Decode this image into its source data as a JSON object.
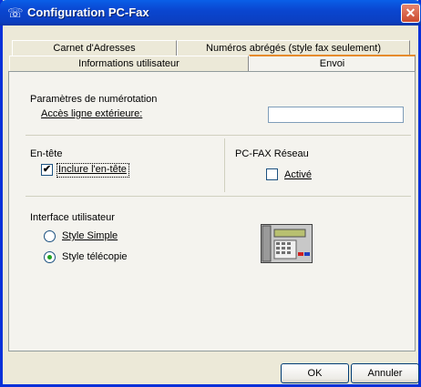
{
  "window": {
    "title": "Configuration PC-Fax",
    "app_icon": "fax-app-icon",
    "close_symbol": "✕"
  },
  "tabs": {
    "row_back": [
      {
        "label": "Carnet d'Adresses"
      },
      {
        "label": "Numéros abrégés (style fax seulement)"
      }
    ],
    "row_front": [
      {
        "label": "Informations utilisateur"
      },
      {
        "label": "Envoi",
        "selected": true
      }
    ]
  },
  "dialing": {
    "section_title": "Paramètres de numérotation",
    "outside_line_label": "Accès ligne extérieure:",
    "outside_line_value": ""
  },
  "header": {
    "section_title": "En-tête",
    "include_label": "Inclure l'en-tête",
    "include_checked": true,
    "check_mark": "✔"
  },
  "network": {
    "section_title": "PC-FAX Réseau",
    "enabled_label": "Activé",
    "enabled_checked": false
  },
  "interface": {
    "section_title": "Interface utilisateur",
    "options": [
      {
        "label": "Style Simple",
        "selected": false
      },
      {
        "label": "Style télécopie",
        "selected": true
      }
    ],
    "illustration": "fax-machine-icon"
  },
  "footer": {
    "ok_label": "OK",
    "cancel_label": "Annuler"
  }
}
